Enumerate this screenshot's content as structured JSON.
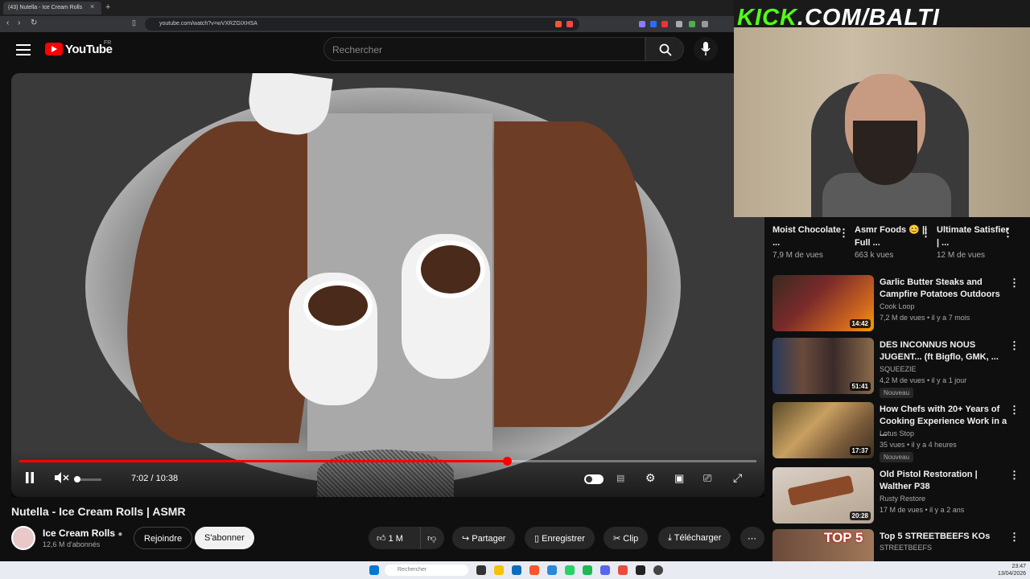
{
  "browser": {
    "tab_title": "(43) Nutella - Ice Cream Rolls",
    "url": "youtube.com/watch?v=wVXRZGIXHSA"
  },
  "header": {
    "logo_text": "YouTube",
    "region": "FR",
    "search_placeholder": "Rechercher"
  },
  "player": {
    "time": "7:02 / 10:38",
    "progress": 0.662
  },
  "video": {
    "title": "Nutella - Ice Cream Rolls | ASMR",
    "channel": "Ice Cream Rolls",
    "subscribers": "12,6 M d'abonnés",
    "join_label": "Rejoindre",
    "subscribe_label": "S'abonner",
    "likes": "1 M",
    "share_label": "Partager",
    "save_label": "Enregistrer",
    "clip_label": "Clip",
    "download_label": "Télécharger"
  },
  "overlay": {
    "kick_green": "KICK",
    "kick_white": ".COM/BALTI"
  },
  "shorts": [
    {
      "title": "Moist Chocolate ...",
      "views": "7,9 M de vues"
    },
    {
      "title": "Asmr Foods 😊 || Full ...",
      "views": "663 k vues"
    },
    {
      "title": "Ultimate Satisfier | ...",
      "views": "12 M de vues"
    }
  ],
  "recommended": [
    {
      "title": "Garlic Butter Steaks and Campfire Potatoes Outdoors",
      "channel": "Cook Loop",
      "meta": "7,2 M de vues • il y a 7 mois",
      "duration": "14:42",
      "badge": ""
    },
    {
      "title": "DES INCONNUS NOUS JUGENT... (ft Bigflo, GMK, ...",
      "channel": "SQUEEZIE",
      "meta": "4,2 M de vues • il y a 1 jour",
      "duration": "51:41",
      "badge": "Nouveau"
    },
    {
      "title": "How Chefs with 20+ Years of Cooking Experience Work in a ...",
      "channel": "Lotus Stop",
      "meta": "35 vues • il y a 4 heures",
      "duration": "17:37",
      "badge": "Nouveau"
    },
    {
      "title": "Old Pistol Restoration | Walther P38",
      "channel": "Rusty Restore",
      "meta": "17 M de vues • il y a 2 ans",
      "duration": "20:28",
      "badge": ""
    },
    {
      "title": "Top 5 STREETBEEFS KOs",
      "channel": "STREETBEEFS",
      "meta": "",
      "duration": "",
      "badge": ""
    }
  ],
  "thumb_overlay": "TOP 5",
  "taskbar": {
    "search_placeholder": "Rechercher",
    "time": "23:47",
    "date": "13/04/2026"
  }
}
